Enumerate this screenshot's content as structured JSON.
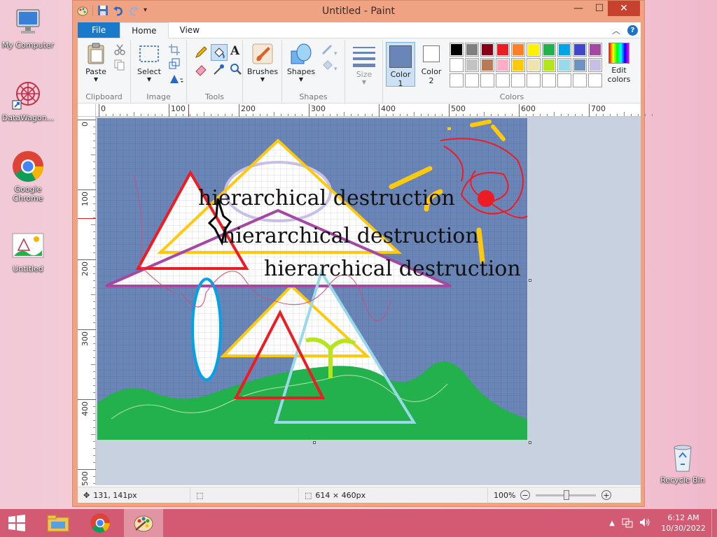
{
  "desktop": {
    "icons": [
      {
        "label": "My Computer"
      },
      {
        "label": "DataWagon..."
      },
      {
        "label": "Google Chrome"
      },
      {
        "label": "Untitled"
      },
      {
        "label": "Recycle Bin"
      }
    ]
  },
  "window": {
    "title": "Untitled - Paint",
    "minimize": "—",
    "maximize": "☐",
    "close": "✕"
  },
  "tabs": {
    "file": "File",
    "home": "Home",
    "view": "View"
  },
  "ribbon": {
    "clipboard": {
      "label": "Clipboard",
      "paste": "Paste"
    },
    "image": {
      "label": "Image",
      "select": "Select"
    },
    "tools": {
      "label": "Tools"
    },
    "brushes": {
      "label": "Brushes"
    },
    "shapes": {
      "label": "Shapes"
    },
    "size": {
      "label": "Size"
    },
    "color1": {
      "label": "Color",
      "num": "1",
      "value": "#6a86b8"
    },
    "color2": {
      "label": "Color",
      "num": "2",
      "value": "#ffffff"
    },
    "colors": {
      "label": "Colors"
    },
    "edit_colors": {
      "label": "Edit",
      "label2": "colors"
    },
    "palette": [
      "#000000",
      "#7f7f7f",
      "#880015",
      "#ed1c24",
      "#ff7f27",
      "#fff200",
      "#22b14c",
      "#00a2e8",
      "#3f48cc",
      "#a349a4",
      "#ffffff",
      "#c3c3c3",
      "#b97a57",
      "#ffaec9",
      "#ffc90e",
      "#efe4b0",
      "#b5e61d",
      "#99d9ea",
      "#7092be",
      "#c8bfe7",
      "#ffffff",
      "#ffffff",
      "#ffffff",
      "#ffffff",
      "#ffffff",
      "#ffffff",
      "#ffffff",
      "#ffffff",
      "#ffffff",
      "#ffffff"
    ]
  },
  "ruler": {
    "h_ticks": [
      "0",
      "100",
      "200",
      "300",
      "400",
      "500",
      "600",
      "700"
    ],
    "v_ticks": [
      "0",
      "100",
      "200",
      "300",
      "400",
      "500"
    ]
  },
  "canvas": {
    "text_lines": [
      "hierarchical destruction",
      "hierarchical destruction",
      "hierarchical destruction"
    ],
    "background": "#6a86b8",
    "grass": "#22b14c"
  },
  "status": {
    "cursor_pos": "131, 141px",
    "selection_size": "",
    "image_size": "614 × 460px",
    "zoom": "100%"
  },
  "taskbar": {
    "time": "6:12 AM",
    "date": "10/30/2022"
  }
}
